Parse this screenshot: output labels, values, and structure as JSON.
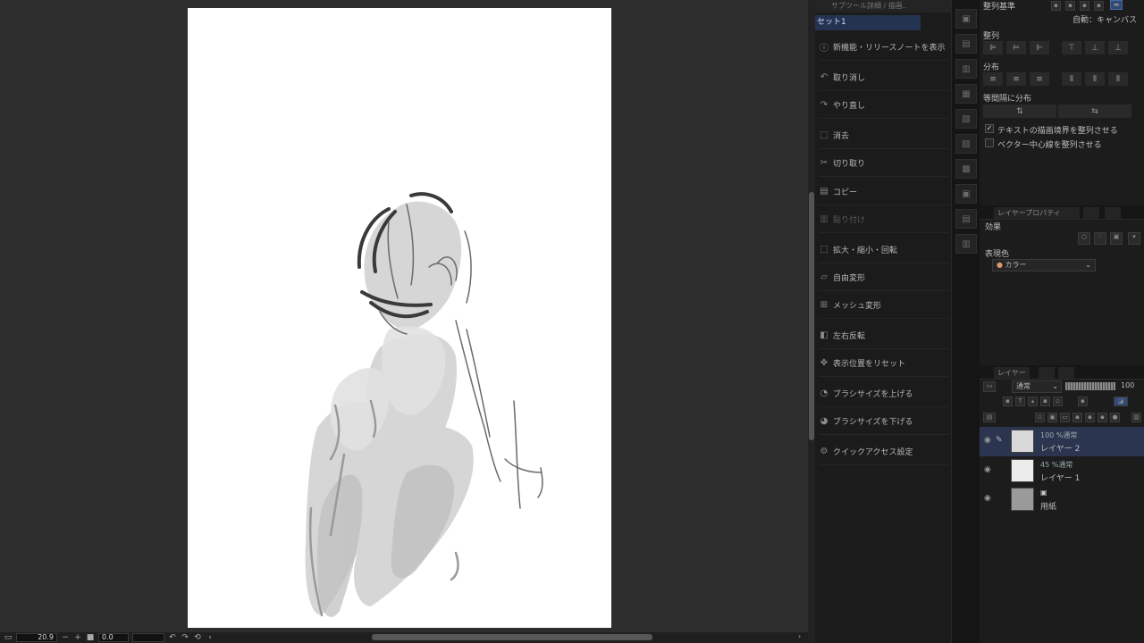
{
  "canvas": {
    "zoom": "20.9",
    "rotation": "0.0"
  },
  "command_bar": {
    "top_title": "サブツール詳細 / 描画..",
    "set_name": "セット1",
    "items": [
      {
        "label": "新機能・リリースノートを表示",
        "icon": "info-icon",
        "enabled": true
      },
      {
        "label": "取り消し",
        "icon": "undo-icon",
        "enabled": true
      },
      {
        "label": "やり直し",
        "icon": "redo-icon",
        "enabled": true
      },
      {
        "label": "消去",
        "icon": "clear-icon",
        "enabled": true
      },
      {
        "label": "切り取り",
        "icon": "scissors-icon",
        "enabled": true
      },
      {
        "label": "コピー",
        "icon": "copy-icon",
        "enabled": true
      },
      {
        "label": "貼り付け",
        "icon": "paste-icon",
        "enabled": false
      },
      {
        "label": "拡大・縮小・回転",
        "icon": "scale-icon",
        "enabled": true
      },
      {
        "label": "自由変形",
        "icon": "free-transform-icon",
        "enabled": true
      },
      {
        "label": "メッシュ変形",
        "icon": "mesh-icon",
        "enabled": true
      },
      {
        "label": "左右反転",
        "icon": "flip-icon",
        "enabled": true
      },
      {
        "label": "表示位置をリセット",
        "icon": "move-icon",
        "enabled": true
      },
      {
        "label": "ブラシサイズを上げる",
        "icon": "brush-up-icon",
        "enabled": true
      },
      {
        "label": "ブラシサイズを下げる",
        "icon": "brush-down-icon",
        "enabled": true
      },
      {
        "label": "クイックアクセス設定",
        "icon": "settings-icon",
        "enabled": true
      }
    ]
  },
  "align_panel": {
    "title": "整列基準",
    "auto_label": "自動：キャンバス",
    "align_label": "整列",
    "distribute_label": "分布",
    "equal_spacing_label": "等間隔に分布",
    "text_bounds_label": "テキストの描画境界を整列させる",
    "text_bounds_checked": true,
    "vector_center_label": "ベクター中心線を整列させる",
    "vector_center_checked": false
  },
  "layer_property": {
    "tab_label": "レイヤープロパティ",
    "effect_label": "効果",
    "expression_color_label": "表現色",
    "expression_color_value": "カラー"
  },
  "layers_panel": {
    "tab_label": "レイヤー",
    "blend_mode": "通常",
    "opacity": "100",
    "layers": [
      {
        "mode": "100 %通常",
        "name": "レイヤー 2",
        "selected": true
      },
      {
        "mode": "45 %通常",
        "name": "レイヤー 1",
        "selected": false
      },
      {
        "mode": "",
        "name": "用紙",
        "selected": false
      }
    ]
  }
}
